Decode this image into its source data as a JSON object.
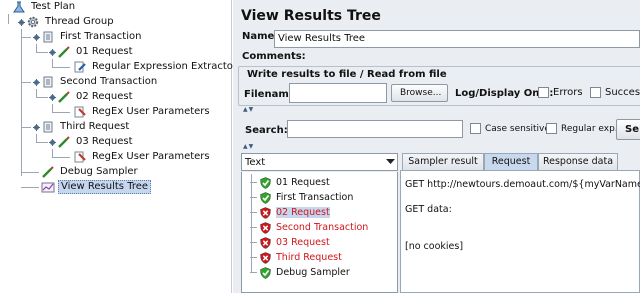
{
  "tree": {
    "items": [
      {
        "label": "Test Plan",
        "icon": "flask-icon"
      },
      {
        "label": "Thread Group",
        "icon": "gear-icon"
      },
      {
        "label": "First Transaction",
        "icon": "transaction-icon"
      },
      {
        "label": "01 Request",
        "icon": "sampler-icon"
      },
      {
        "label": "Regular Expression Extractor",
        "icon": "extractor-icon"
      },
      {
        "label": "Second Transaction",
        "icon": "transaction-icon"
      },
      {
        "label": "02 Request",
        "icon": "sampler-icon"
      },
      {
        "label": "RegEx User Parameters",
        "icon": "preprocessor-icon"
      },
      {
        "label": "Third Request",
        "icon": "transaction-icon"
      },
      {
        "label": "03 Request",
        "icon": "sampler-icon"
      },
      {
        "label": "RegEx User Parameters",
        "icon": "preprocessor-icon"
      },
      {
        "label": "Debug Sampler",
        "icon": "sampler-icon"
      },
      {
        "label": "View Results Tree",
        "icon": "listener-icon"
      }
    ]
  },
  "panel": {
    "title": "View Results Tree",
    "name_label": "Name:",
    "name_value": "View Results Tree",
    "comments_label": "Comments:",
    "write_results_legend": "Write results to file / Read from file",
    "filename_label": "Filename",
    "filename_value": "",
    "browse_label": "Browse...",
    "log_display_label": "Log/Display Only:",
    "errors_label": "Errors",
    "successes_label": "Successes",
    "search_label": "Search:",
    "search_value": "",
    "case_sensitive_label": "Case sensitive",
    "regular_exp_label": "Regular exp.",
    "search_button_label": "Se"
  },
  "renderer": {
    "selected": "Text"
  },
  "results": [
    {
      "label": "01 Request",
      "status": "success"
    },
    {
      "label": "First Transaction",
      "status": "success"
    },
    {
      "label": "02 Request",
      "status": "error"
    },
    {
      "label": "Second Transaction",
      "status": "error"
    },
    {
      "label": "03 Request",
      "status": "error"
    },
    {
      "label": "Third Request",
      "status": "error"
    },
    {
      "label": "Debug Sampler",
      "status": "success"
    }
  ],
  "tabs": [
    "Sampler result",
    "Request",
    "Response data"
  ],
  "active_tab": "Request",
  "request_content": {
    "line1": "GET http://newtours.demoaut.com/${myVarName}.php",
    "line2": "GET data:",
    "line3": "[no cookies]"
  },
  "colors": {
    "panel_bg": "#eaedf1",
    "selection": "#c5d7ee",
    "error_text": "#d0161b",
    "success_shield": "#2fa52b",
    "error_shield": "#d0161b"
  }
}
